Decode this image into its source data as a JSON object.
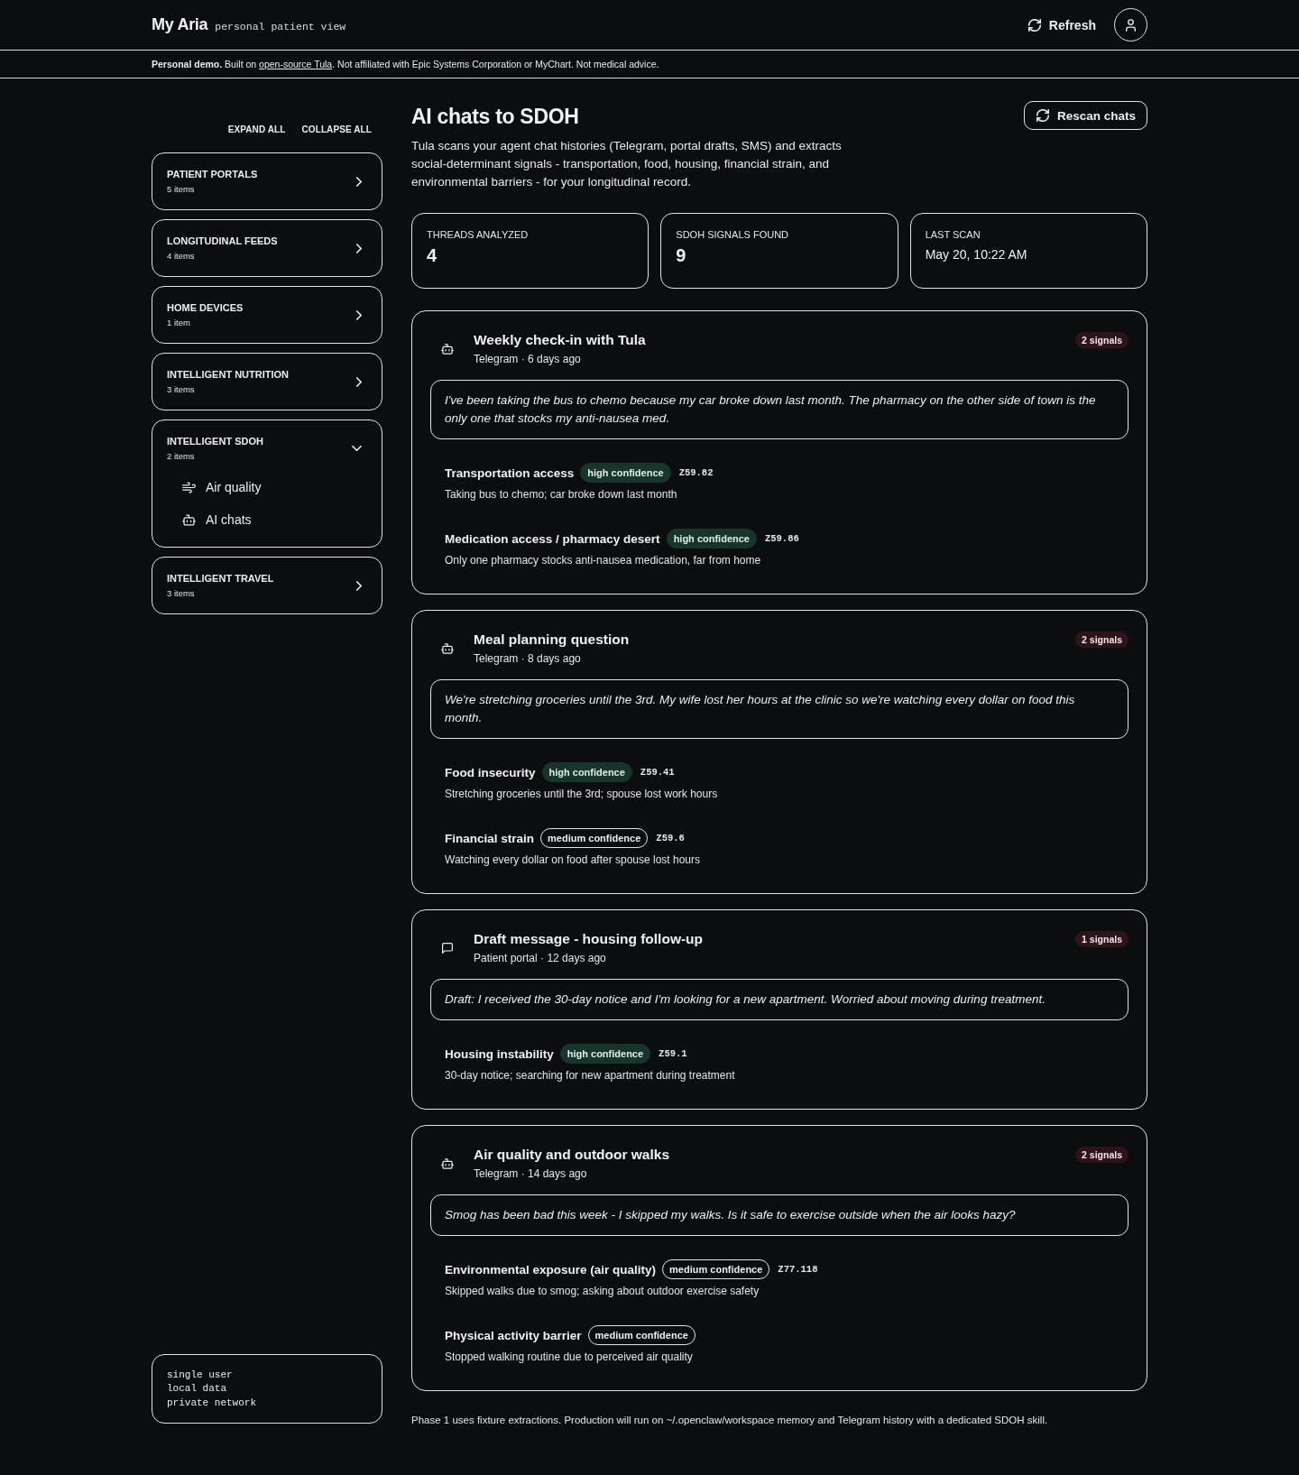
{
  "header": {
    "brand": "My Aria",
    "tagline": "personal patient view",
    "refresh": "Refresh"
  },
  "disclaimer": {
    "before": "**Personal demo.** Built on",
    "link": "open-source Tula",
    "after": ". Not affiliated with Epic Systems Corporation or MyChart. Not medical advice."
  },
  "sidebar": {
    "actions": [
      "EXPAND ALL",
      "COLLAPSE ALL"
    ],
    "groups": [
      {
        "title": "PATIENT PORTALS",
        "count": "5 items",
        "expanded": false
      },
      {
        "title": "LONGITUDINAL FEEDS",
        "count": "4 items",
        "expanded": false
      },
      {
        "title": "HOME DEVICES",
        "count": "1 item",
        "expanded": false
      },
      {
        "title": "INTELLIGENT NUTRITION",
        "count": "3 items",
        "expanded": false
      },
      {
        "title": "INTELLIGENT SDOH",
        "count": "2 items",
        "expanded": true,
        "children": [
          {
            "label": "Air quality",
            "kind": "wind"
          },
          {
            "label": "AI chats",
            "kind": "bot"
          }
        ]
      },
      {
        "title": "INTELLIGENT TRAVEL",
        "count": "3 items",
        "expanded": false
      }
    ],
    "info_lines": [
      "single user",
      "local data",
      "private network"
    ]
  },
  "page": {
    "title": "AI chats to SDOH",
    "rescan": "Rescan chats",
    "description": "Tula scans your agent chat histories (Telegram, portal drafts, SMS) and extracts social-determinant signals - transportation, food, housing, financial strain, and environmental barriers - for your longitudinal record.",
    "stats": [
      {
        "label": "THREADS ANALYZED",
        "value": "4",
        "kind": "count"
      },
      {
        "label": "SDOH SIGNALS FOUND",
        "value": "9",
        "kind": "count"
      },
      {
        "label": "LAST SCAN",
        "value": "May 20, 10:22 AM",
        "kind": "time"
      }
    ]
  },
  "threads": [
    {
      "kind": "bot",
      "title": "Weekly check-in with Tula",
      "meta": "Telegram · 6 days ago",
      "signal_count": "2 signals",
      "quote": "I've been taking the bus to chemo because my car broke down last month. The pharmacy on the other side of town is the only one that stocks my anti-nausea med.",
      "signals": [
        {
          "label": "Transportation access",
          "confidence": "high confidence",
          "kind": "high",
          "code": "Z59.82",
          "description": "Taking bus to chemo; car broke down last month"
        },
        {
          "label": "Medication access / pharmacy desert",
          "confidence": "high confidence",
          "kind": "high",
          "code": "Z59.86",
          "description": "Only one pharmacy stocks anti-nausea medication, far from home"
        }
      ]
    },
    {
      "kind": "bot",
      "title": "Meal planning question",
      "meta": "Telegram · 8 days ago",
      "signal_count": "2 signals",
      "quote": "We're stretching groceries until the 3rd. My wife lost her hours at the clinic so we're watching every dollar on food this month.",
      "signals": [
        {
          "label": "Food insecurity",
          "confidence": "high confidence",
          "kind": "high",
          "code": "Z59.41",
          "description": "Stretching groceries until the 3rd; spouse lost work hours"
        },
        {
          "label": "Financial strain",
          "confidence": "medium confidence",
          "kind": "medium",
          "code": "Z59.6",
          "description": "Watching every dollar on food after spouse lost hours"
        }
      ]
    },
    {
      "kind": "message",
      "title": "Draft message - housing follow-up",
      "meta": "Patient portal · 12 days ago",
      "signal_count": "1 signals",
      "quote": "Draft: I received the 30-day notice and I'm looking for a new apartment. Worried about moving during treatment.",
      "signals": [
        {
          "label": "Housing instability",
          "confidence": "high confidence",
          "kind": "high",
          "code": "Z59.1",
          "description": "30-day notice; searching for new apartment during treatment"
        }
      ]
    },
    {
      "kind": "bot",
      "title": "Air quality and outdoor walks",
      "meta": "Telegram · 14 days ago",
      "signal_count": "2 signals",
      "quote": "Smog has been bad this week - I skipped my walks. Is it safe to exercise outside when the air looks hazy?",
      "signals": [
        {
          "label": "Environmental exposure (air quality)",
          "confidence": "medium confidence",
          "kind": "medium",
          "code": "Z77.118",
          "description": "Skipped walks due to smog; asking about outdoor exercise safety"
        },
        {
          "label": "Physical activity barrier",
          "confidence": "medium confidence",
          "kind": "medium",
          "description": "Stopped walking routine due to perceived air quality"
        }
      ]
    }
  ],
  "footer_note": "Phase 1 uses fixture extractions. Production will run on ~/.openclaw/workspace memory and Telegram history with a dedicated SDOH skill."
}
